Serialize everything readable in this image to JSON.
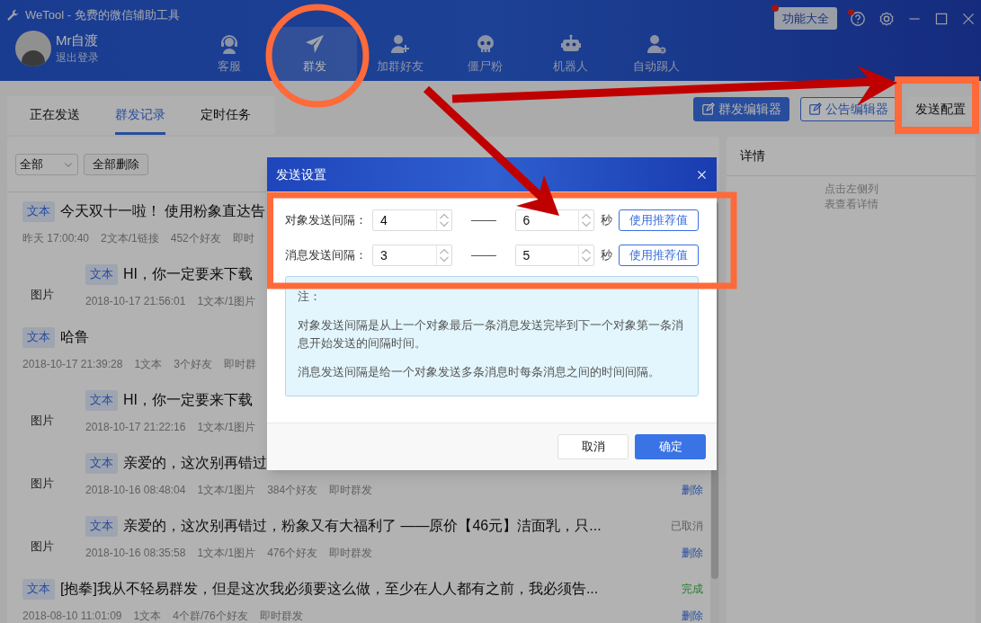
{
  "window": {
    "title": "WeTool - 免费的微信辅助工具"
  },
  "user": {
    "name": "Mr自渡",
    "logout": "退出登录"
  },
  "nav": [
    {
      "label": "客服",
      "kind": "headset",
      "selected": false
    },
    {
      "label": "群发",
      "kind": "plane",
      "selected": true
    },
    {
      "label": "加群好友",
      "kind": "person-plus",
      "selected": false
    },
    {
      "label": "僵尸粉",
      "kind": "skull",
      "selected": false
    },
    {
      "label": "机器人",
      "kind": "robot",
      "selected": false
    },
    {
      "label": "自动踢人",
      "kind": "person-x",
      "selected": false
    }
  ],
  "features_button": {
    "label": "功能大全",
    "badge": true
  },
  "help_badge": true,
  "tabs": [
    {
      "label": "正在发送",
      "selected": false
    },
    {
      "label": "群发记录",
      "selected": true
    },
    {
      "label": "定时任务",
      "selected": false
    }
  ],
  "toolbar_buttons": [
    {
      "label": "群发编辑器",
      "kind": "primary"
    },
    {
      "label": "公告编辑器",
      "kind": "outline"
    },
    {
      "label": "发送配置",
      "kind": "plain"
    }
  ],
  "filter": {
    "value": "全部",
    "delete_all": "全部删除"
  },
  "records": [
    {
      "kind": "text",
      "tag": "文本",
      "text": "今天双十一啦！ 使用粉象直达告",
      "meta": [
        "昨天 17:00:40",
        "2文本/1链接",
        "452个好友",
        "即时"
      ]
    },
    {
      "kind": "media",
      "media": "图片",
      "tag": "文本",
      "text": "HI，你一定要来下载",
      "meta": [
        "2018-10-17 21:56:01",
        "1文本/1图片"
      ]
    },
    {
      "kind": "text",
      "tag": "文本",
      "text": "哈鲁",
      "meta": [
        "2018-10-17 21:39:28",
        "1文本",
        "3个好友",
        "即时群"
      ]
    },
    {
      "kind": "media",
      "media": "图片",
      "tag": "文本",
      "text": "HI，你一定要来下载",
      "meta": [
        "2018-10-17 21:22:16",
        "1文本/1图片"
      ]
    },
    {
      "kind": "media",
      "media": "图片",
      "tag": "文本",
      "text": "亲爱的，这次别再错过",
      "meta": [
        "2018-10-16 08:48:04",
        "1文本/1图片",
        "384个好友",
        "即时群发"
      ],
      "action": "删除"
    },
    {
      "kind": "media",
      "media": "图片",
      "tag": "文本",
      "text": "亲爱的，这次别再错过，粉象又有大福利了 ——原价【46元】洁面乳，只...",
      "status": {
        "text": "已取消",
        "kind": "cancelled"
      },
      "meta": [
        "2018-10-16 08:35:58",
        "1文本/1图片",
        "476个好友",
        "即时群发"
      ],
      "action": "删除"
    },
    {
      "kind": "text",
      "tag": "文本",
      "text": "[抱拳]我从不轻易群发，但是这次我必须要这么做，至少在人人都有之前，我必须告...",
      "status": {
        "text": "完成",
        "kind": "done"
      },
      "meta": [
        "2018-08-10 11:01:09",
        "1文本",
        "4个群/76个好友",
        "即时群发"
      ],
      "action": "删除"
    }
  ],
  "details": {
    "title": "详情",
    "empty": "点击左侧列表查看详情"
  },
  "dialog": {
    "title": "发送设置",
    "rows": [
      {
        "label": "对象发送间隔：",
        "from": "4",
        "to": "6",
        "unit": "秒",
        "button": "使用推荐值"
      },
      {
        "label": "消息发送间隔：",
        "from": "3",
        "to": "5",
        "unit": "秒",
        "button": "使用推荐值"
      }
    ],
    "note": {
      "heading": "注：",
      "paragraphs": [
        "对象发送间隔是从上一个对象最后一条消息发送完毕到下一个对象第一条消息开始发送的间隔时间。",
        "消息发送间隔是给一个对象发送多条消息时每条消息之间的时间间隔。"
      ]
    },
    "buttons": [
      {
        "label": "取消",
        "kind": "secondary"
      },
      {
        "label": "确定",
        "kind": "primary"
      }
    ]
  }
}
